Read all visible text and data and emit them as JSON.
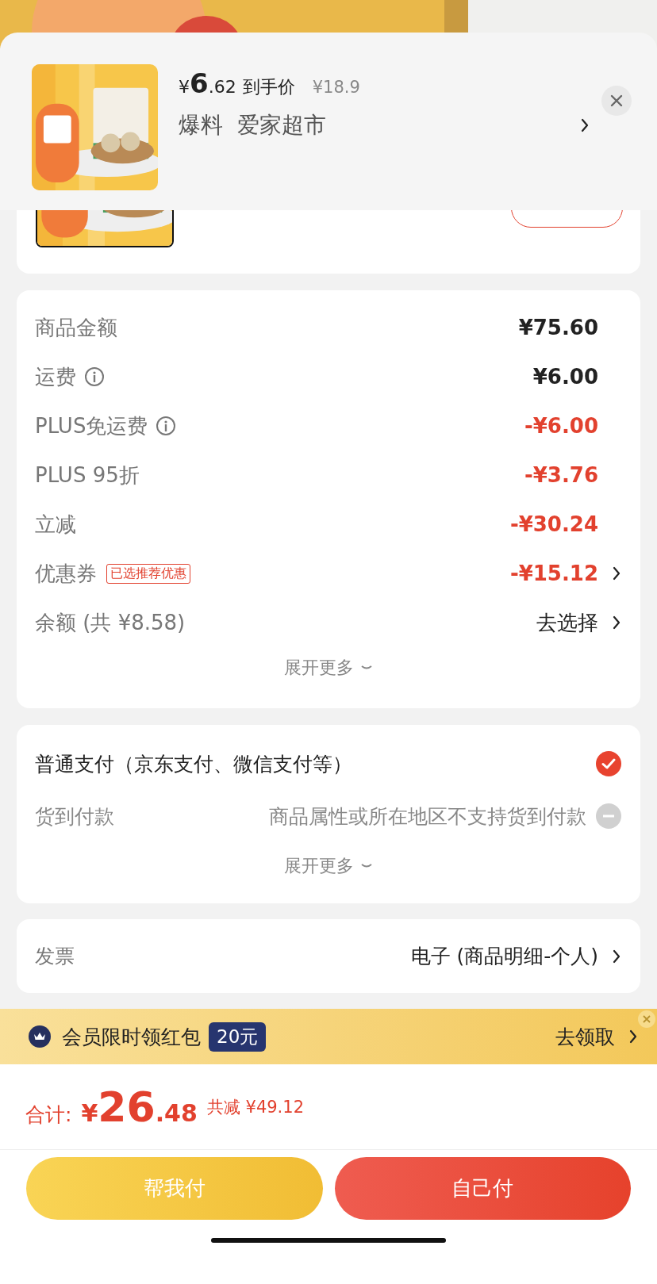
{
  "popup": {
    "price_symbol": "¥",
    "price_int": "6",
    "price_dec": ".62",
    "price_label": "到手价",
    "original_price": "¥18.9",
    "tag": "爆料",
    "store": "爱家超市"
  },
  "amounts": {
    "rows": [
      {
        "label": "商品金额",
        "info": false,
        "value": "¥75.60",
        "kind": "normal",
        "chevron": false
      },
      {
        "label": "运费",
        "info": true,
        "value": "¥6.00",
        "kind": "normal",
        "chevron": false
      },
      {
        "label": "PLUS免运费",
        "info": true,
        "value": "-¥6.00",
        "kind": "discount",
        "chevron": false
      },
      {
        "label": "PLUS 95折",
        "info": false,
        "value": "-¥3.76",
        "kind": "discount",
        "chevron": false
      },
      {
        "label": "立减",
        "info": false,
        "value": "-¥30.24",
        "kind": "discount",
        "chevron": false
      },
      {
        "label": "优惠券",
        "info": false,
        "tag": "已选推荐优惠",
        "value": "-¥15.12",
        "kind": "discount",
        "chevron": true
      },
      {
        "label": "余额 (共 ¥8.58)",
        "info": false,
        "value": "去选择",
        "kind": "action",
        "chevron": true
      }
    ],
    "expand": "展开更多"
  },
  "payment": {
    "options": [
      {
        "label": "普通支付（京东支付、微信支付等）",
        "selected": true,
        "disabled": false
      },
      {
        "label": "货到付款",
        "note": "商品属性或所在地区不支持货到付款",
        "selected": false,
        "disabled": true
      }
    ],
    "expand": "展开更多"
  },
  "invoice": {
    "label": "发票",
    "value": "电子 (商品明细-个人)"
  },
  "banner": {
    "text": "会员限时领红包",
    "badge": "20元",
    "action": "去领取"
  },
  "total": {
    "label": "合计:",
    "symbol": "¥",
    "int": "26",
    "dec": ".48",
    "saved_label": "共减",
    "saved": "¥49.12"
  },
  "buttons": [
    {
      "label": "帮我付",
      "kind": "secondary"
    },
    {
      "label": "自己付",
      "kind": "primary"
    }
  ]
}
